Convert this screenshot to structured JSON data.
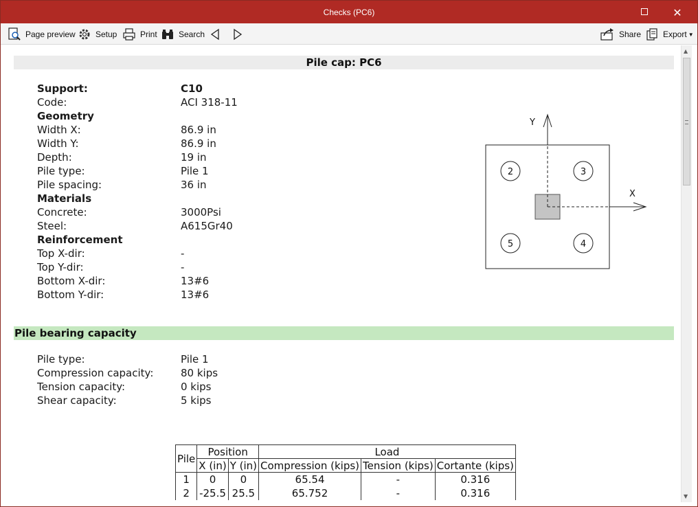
{
  "window": {
    "title": "Checks (PC6)"
  },
  "toolbar": {
    "page_preview": "Page preview",
    "setup": "Setup",
    "print": "Print",
    "search": "Search",
    "share": "Share",
    "export": "Export"
  },
  "report": {
    "heading": "Pile cap: PC6",
    "support": {
      "label": "Support:",
      "value": "C10"
    },
    "code": {
      "label": "Code:",
      "value": "ACI 318-11"
    },
    "geometry_header": "Geometry",
    "width_x": {
      "label": "Width X:",
      "value": "86.9 in"
    },
    "width_y": {
      "label": "Width Y:",
      "value": "86.9 in"
    },
    "depth": {
      "label": "Depth:",
      "value": "19 in"
    },
    "pile_type": {
      "label": "Pile type:",
      "value": "Pile 1"
    },
    "pile_spacing": {
      "label": "Pile spacing:",
      "value": "36 in"
    },
    "materials_header": "Materials",
    "concrete": {
      "label": "Concrete:",
      "value": "3000Psi"
    },
    "steel": {
      "label": "Steel:",
      "value": "A615Gr40"
    },
    "reinforcement_header": "Reinforcement",
    "top_x": {
      "label": "Top X-dir:",
      "value": "-"
    },
    "top_y": {
      "label": "Top Y-dir:",
      "value": "-"
    },
    "bottom_x": {
      "label": "Bottom X-dir:",
      "value": "13#6"
    },
    "bottom_y": {
      "label": "Bottom Y-dir:",
      "value": "13#6"
    }
  },
  "diagram": {
    "axis_y": "Y",
    "axis_x": "X",
    "piles": [
      "2",
      "3",
      "5",
      "4"
    ]
  },
  "bearing": {
    "heading": "Pile bearing capacity",
    "pile_type": {
      "label": "Pile type:",
      "value": "Pile 1"
    },
    "compression": {
      "label": "Compression capacity:",
      "value": "80 kips"
    },
    "tension": {
      "label": "Tension capacity:",
      "value": "0 kips"
    },
    "shear": {
      "label": "Shear capacity:",
      "value": "5 kips"
    }
  },
  "table": {
    "col_pile": "Pile",
    "group_position": "Position",
    "group_load": "Load",
    "col_x": "X (in)",
    "col_y": "Y (in)",
    "col_compression": "Compression (kips)",
    "col_tension": "Tension (kips)",
    "col_cortante": "Cortante (kips)",
    "rows": [
      {
        "pile": "1",
        "x": "0",
        "y": "0",
        "compression": "65.54",
        "tension": "-",
        "cortante": "0.316"
      },
      {
        "pile": "2",
        "x": "-25.5",
        "y": "25.5",
        "compression": "65.752",
        "tension": "-",
        "cortante": "0.316"
      }
    ]
  }
}
